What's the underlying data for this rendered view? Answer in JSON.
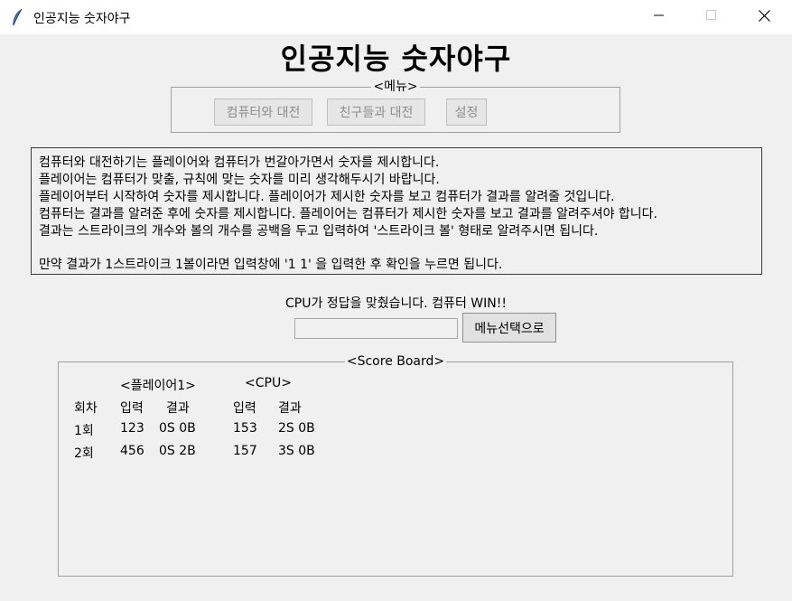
{
  "window": {
    "title": "인공지능 숫자야구",
    "icon": "feather-icon"
  },
  "header": {
    "title": "인공지능 숫자야구"
  },
  "menu": {
    "legend": "<메뉴>",
    "buttons": {
      "vs_computer": "컴퓨터와 대전",
      "vs_friends": "친구들과 대전",
      "settings": "설정"
    }
  },
  "rules": {
    "lines": [
      "컴퓨터와 대전하기는 플레이어와 컴퓨터가 번갈아가면서 숫자를 제시합니다.",
      "플레이어는 컴퓨터가 맞출, 규칙에 맞는 숫자를 미리 생각해두시기 바랍니다.",
      "플레이어부터 시작하여 숫자를 제시합니다. 플레이어가 제시한 숫자를 보고 컴퓨터가 결과를 알려줄 것입니다.",
      "컴퓨터는 결과를 알려준 후에 숫자를 제시합니다. 플레이어는 컴퓨터가 제시한 숫자를 보고 결과를 알려주셔야 합니다.",
      "결과는 스트라이크의 개수와 볼의 개수를 공백을 두고 입력하여 '스트라이크 볼' 형태로 알려주시면 됩니다.",
      "만약 결과가 1스트라이크 1볼이라면 입력창에 '1 1' 을 입력한 후 확인을 누르면 됩니다."
    ]
  },
  "status": {
    "message": "CPU가 정답을 맞췄습니다. 컴퓨터 WIN!!"
  },
  "input": {
    "value": "",
    "back_button": "메뉴선택으로"
  },
  "scoreboard": {
    "legend": "<Score Board>",
    "player_header": "<플레이어1>",
    "cpu_header": "<CPU>",
    "columns": {
      "round": "회차",
      "player_input": "입력",
      "player_result": "결과",
      "cpu_input": "입력",
      "cpu_result": "결과"
    },
    "rows": [
      {
        "round": "1회",
        "player_input": "123",
        "player_result": "0S 0B",
        "cpu_input": "153",
        "cpu_result": "2S 0B"
      },
      {
        "round": "2회",
        "player_input": "456",
        "player_result": "0S 2B",
        "cpu_input": "157",
        "cpu_result": "3S 0B"
      }
    ]
  }
}
